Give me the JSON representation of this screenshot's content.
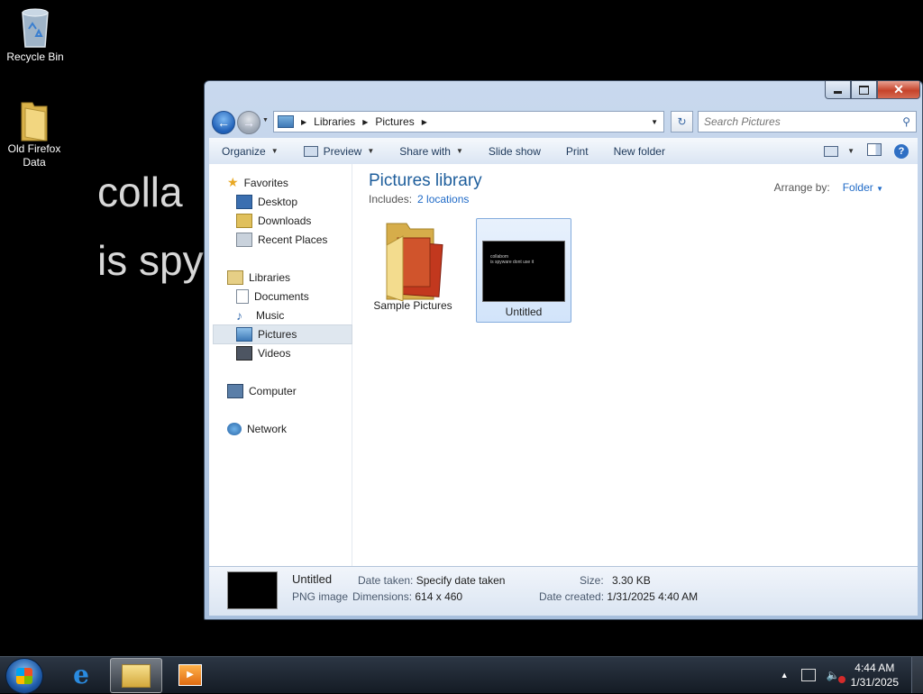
{
  "desktop": {
    "icons": [
      {
        "label": "Recycle Bin",
        "icon": "recycle-bin-icon"
      },
      {
        "label": "Old Firefox\nData",
        "icon": "folder-icon"
      }
    ],
    "background_text": [
      "colla",
      "is spy"
    ]
  },
  "window": {
    "title_buttons": {
      "minimize": "▬",
      "maximize": "▢",
      "close": "✕"
    },
    "breadcrumb": [
      "Libraries",
      "Pictures"
    ],
    "search_placeholder": "Search Pictures",
    "toolbar": {
      "organize": "Organize",
      "preview": "Preview",
      "share_with": "Share with",
      "slide_show": "Slide show",
      "print": "Print",
      "new_folder": "New folder"
    },
    "nav": {
      "favorites": "Favorites",
      "desktop": "Desktop",
      "downloads": "Downloads",
      "recent_places": "Recent Places",
      "libraries": "Libraries",
      "documents": "Documents",
      "music": "Music",
      "pictures": "Pictures",
      "videos": "Videos",
      "computer": "Computer",
      "network": "Network"
    },
    "library": {
      "title": "Pictures library",
      "includes_label": "Includes:",
      "includes_link": "2 locations",
      "arrange_label": "Arrange by:",
      "arrange_value": "Folder"
    },
    "files": [
      {
        "name": "Sample Pictures",
        "type": "folder"
      },
      {
        "name": "Untitled",
        "type": "image",
        "selected": true,
        "thumb_text": [
          "collabom",
          "is spyware dont use it"
        ]
      }
    ],
    "details": {
      "name": "Untitled",
      "type": "PNG image",
      "date_taken_label": "Date taken:",
      "date_taken_value": "Specify date taken",
      "dimensions_label": "Dimensions:",
      "dimensions_value": "614 x 460",
      "size_label": "Size:",
      "size_value": "3.30 KB",
      "date_created_label": "Date created:",
      "date_created_value": "1/31/2025 4:40 AM"
    }
  },
  "taskbar": {
    "time": "4:44 AM",
    "date": "1/31/2025"
  }
}
